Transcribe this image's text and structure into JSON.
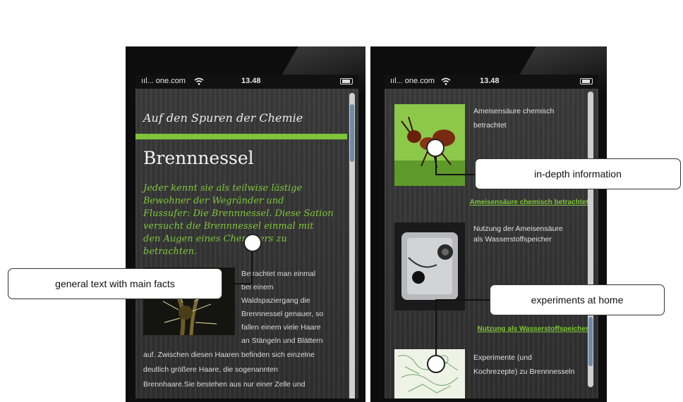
{
  "left_phone": {
    "status": {
      "carrier": "ııl... one.com",
      "wifi": "wifi-icon",
      "time": "13.48",
      "battery": "battery-icon"
    },
    "site_title": "Auf den Spuren der Chemie",
    "heading": "Brennnessel",
    "intro_lines": [
      "Jeder kennt sie als teilwise lästige",
      "Bewohner der Wegränder und",
      "Flussufer: Die Brennnessel. Diese Sation",
      "versucht die Brennnessel einmal mit",
      "den Augen eines Chemikers zu",
      "betrachten."
    ],
    "body_side_lines": [
      "Betrachtet man einmal",
      "bei einem",
      "Waldspaziergang die",
      "Brennnessel genauer, so",
      "fallen einem viele Haare",
      "an Stängeln und Blättern"
    ],
    "body_full_lines": [
      "auf. Zwischen diesen Haaren befinden sich einzelne",
      "deutlich größere Haare, die sogenannten",
      "Brennhaare.Sie bestehen aus nur einer Zelle und"
    ]
  },
  "right_phone": {
    "status": {
      "carrier": "ııl... one.com",
      "wifi": "wifi-icon",
      "time": "13.48",
      "battery": "battery-icon"
    },
    "items": [
      {
        "caption_lines": [
          "Ameisensäure chemisch",
          "betrachtet"
        ],
        "link": "Ameisensäure chemisch betrachtet",
        "icon": "ant-photo"
      },
      {
        "caption_lines": [
          "Nutzung der Ameisensäure",
          "als Wasserstoffspeicher"
        ],
        "link": "Nutzung als Wasserstoffspeicher",
        "icon": "apparatus-photo"
      },
      {
        "caption_lines": [
          "Experimente (und",
          "Kochrezepte) zu Brennnesseln"
        ],
        "link": "",
        "icon": "recipe-sketch"
      }
    ]
  },
  "callouts": {
    "general": "general text with main facts",
    "indepth": "in-depth information",
    "experiments": "experiments at home"
  }
}
